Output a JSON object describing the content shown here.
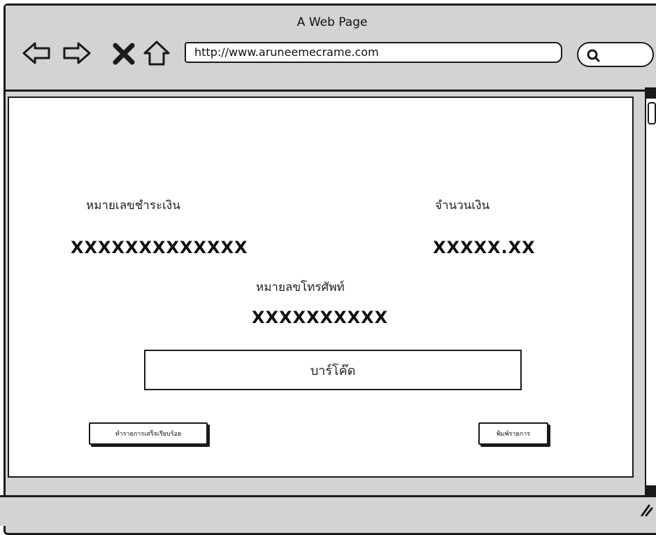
{
  "window": {
    "title": "A Web Page",
    "url": "http://www.aruneemecrame.com"
  },
  "toolbar": {
    "icons": [
      "back-arrow-icon",
      "forward-arrow-icon",
      "stop-icon",
      "home-icon",
      "search-icon"
    ]
  },
  "payment": {
    "ref_label": "หมายเลขชำระเงิน",
    "ref_value": "XXXXXXXXXXXXX",
    "amount_label": "จำนวนเงิน",
    "amount_value": "XXXXX.XX",
    "phone_label": "หมายลขโทรศัพท์",
    "phone_value": "XXXXXXXXXX",
    "barcode_label": "บาร์โค๊ด"
  },
  "buttons": {
    "complete_label": "ทำรายการเสร็จเรียบร้อย",
    "print_label": "พิมพ์รายการ"
  },
  "colors": {
    "chrome": "#d3d3d3",
    "stroke": "#1a1a1a",
    "content": "#ffffff"
  }
}
